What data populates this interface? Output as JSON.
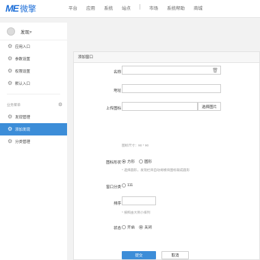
{
  "brand": {
    "mark": "ME",
    "name": "微擎"
  },
  "topnav": {
    "items": [
      "平台",
      "应用",
      "系统",
      "站点",
      "市场",
      "系统帮助",
      "商城"
    ]
  },
  "sidebar": {
    "header": "发现+",
    "items": [
      "应用入口",
      "参数设置",
      "权限设置",
      "默认入口"
    ],
    "group_label": "业务菜单",
    "group_items": [
      "发现管理",
      "添加发现",
      "分类管理"
    ]
  },
  "panel": {
    "title": "添加窗口",
    "name_label": "名称",
    "url_label": "地址",
    "icon_label": "上传图标",
    "upload_button": "选择图片",
    "icon_size_help": "图标尺寸：90 * 90",
    "shape_label": "图标形状",
    "shape_options": [
      "方形",
      "圆形"
    ],
    "shape_help": "* 选择圆形，发现栏目自动将模块图标裁成圆形",
    "category_label": "窗口分类",
    "category_value": "111",
    "order_label": "排序",
    "order_help": "* 按照由大到小排列",
    "status_label": "状态",
    "status_options": [
      "开启",
      "关闭"
    ],
    "submit_label": "提交",
    "cancel_label": "取消"
  }
}
